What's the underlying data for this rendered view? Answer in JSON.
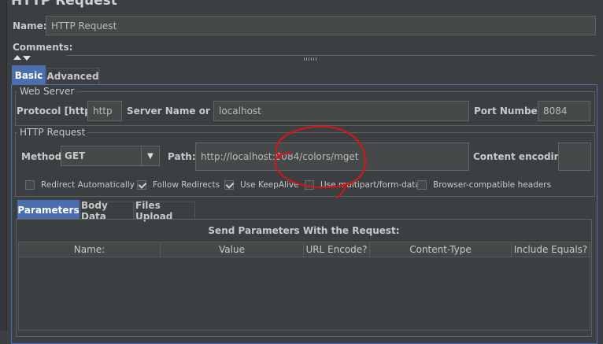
{
  "panel": {
    "title": "HTTP Request",
    "name_label": "Name:",
    "name_value": "HTTP Request",
    "comments_label": "Comments:"
  },
  "tabs": {
    "basic": "Basic",
    "advanced": "Advanced"
  },
  "web_server": {
    "title": "Web Server",
    "protocol_label": "Protocol [http]:",
    "protocol_value": "http",
    "server_label": "Server Name or IP:",
    "server_value": "localhost",
    "port_label": "Port Number:",
    "port_value": "8084"
  },
  "http_request": {
    "title": "HTTP Request",
    "method_label": "Method:",
    "method_value": "GET",
    "path_label": "Path:",
    "path_value": "http://localhost:8084/colors/mget",
    "encoding_label": "Content encoding:",
    "encoding_value": ""
  },
  "checkboxes": [
    {
      "label": "Redirect Automatically",
      "checked": false
    },
    {
      "label": "Follow Redirects",
      "checked": true
    },
    {
      "label": "Use KeepAlive",
      "checked": true
    },
    {
      "label": "Use multipart/form-data",
      "checked": false
    },
    {
      "label": "Browser-compatible headers",
      "checked": false
    }
  ],
  "sub_tabs": {
    "parameters": "Parameters",
    "body_data": "Body Data",
    "files_upload": "Files Upload"
  },
  "params_table": {
    "caption": "Send Parameters With the Request:",
    "columns": [
      "Name:",
      "Value",
      "URL Encode?",
      "Content-Type",
      "Include Equals?"
    ]
  },
  "colors": {
    "background": "#3c3f41",
    "field": "#45494a",
    "active_tab": "#4b6eaf",
    "annotation": "#d01818"
  }
}
